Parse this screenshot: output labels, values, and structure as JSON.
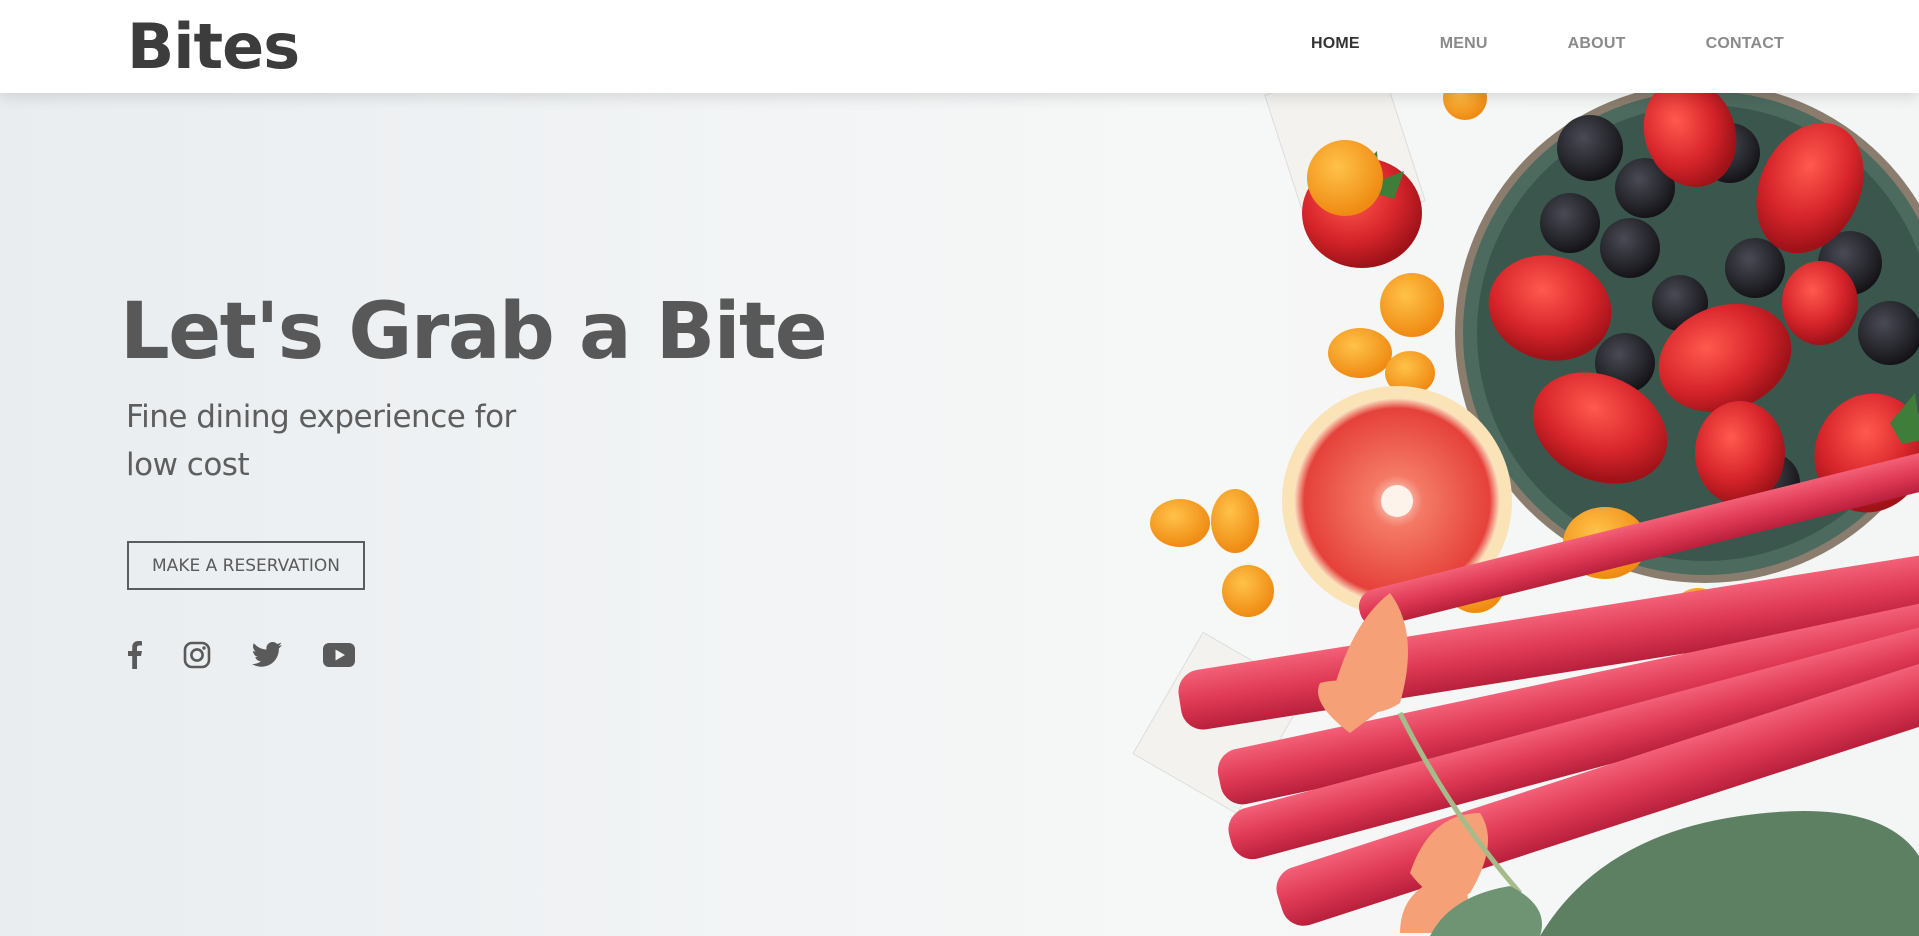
{
  "brand": {
    "name": "Bites"
  },
  "nav": [
    {
      "label": "HOME",
      "active": true
    },
    {
      "label": "MENU",
      "active": false
    },
    {
      "label": "ABOUT",
      "active": false
    },
    {
      "label": "CONTACT",
      "active": false
    }
  ],
  "hero": {
    "headline": "Let's Grab a Bite",
    "subline": "Fine dining experience for low cost",
    "cta_label": "MAKE A RESERVATION"
  },
  "social": [
    {
      "icon": "facebook-icon"
    },
    {
      "icon": "instagram-icon"
    },
    {
      "icon": "twitter-icon"
    },
    {
      "icon": "youtube-icon"
    }
  ],
  "colors": {
    "text_dark": "#3c3c3c",
    "text_mid": "#585858",
    "nav_inactive": "#8a8a8a",
    "strawberry": "#d8262c",
    "rhubarb": "#e0475c",
    "orange": "#f7a42a"
  }
}
